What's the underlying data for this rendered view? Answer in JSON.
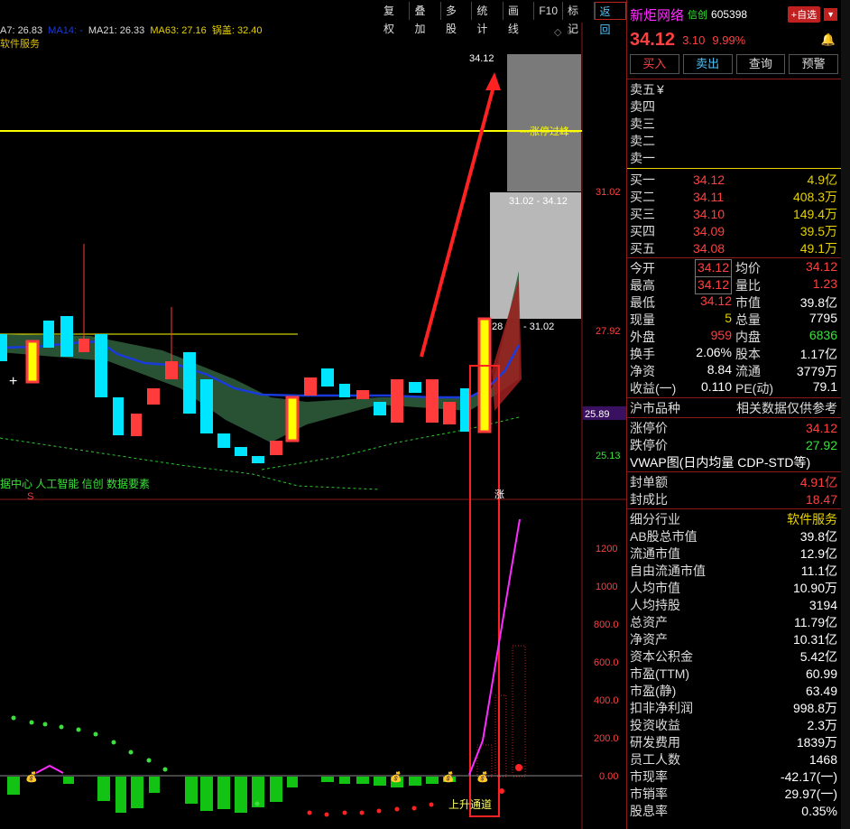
{
  "toolbar": [
    "复权",
    "叠加",
    "多股",
    "统计",
    "画线",
    "F10",
    "标记",
    "返回"
  ],
  "ma_legend": {
    "ma7": "A7: 26.83",
    "ma14": "MA14: -",
    "ma21": "MA21: 26.33",
    "ma63": "MA63: 27.16",
    "guogai": "锅盖: 32.40"
  },
  "sector_label": "软件服务",
  "chart": {
    "price_axis": [
      "31.02",
      "27.92",
      "25.13"
    ],
    "current_price_tag": "25.89",
    "high_label": "34.12",
    "limit_label": "---涨停过峰---",
    "range_label": "31.02 - 34.12",
    "range_label_2": "28",
    "range_label_3": "- 31.02",
    "concept_text": "据中心 人工智能 信创 数据要素",
    "s_marker": "S",
    "zhang_marker": "涨",
    "indicator_axis": [
      "1200",
      "1000",
      "800.0",
      "600.0",
      "400.0",
      "200.0",
      "0.00"
    ],
    "rising_channel": "上升通道",
    "colors": {
      "up": "#ff3b3b",
      "down": "#00e5ff",
      "ma": "#1a3bdc",
      "limit": "#ffff00",
      "magenta": "#ff2cff"
    }
  },
  "stock": {
    "name": "新炬网络",
    "tag": "信创",
    "code": "605398",
    "fav_button": "+自选",
    "price": "34.12",
    "change": "3.10",
    "pct": "9.99%"
  },
  "actions": [
    "买入",
    "卖出",
    "查询",
    "预警"
  ],
  "sell_levels": [
    {
      "label": "卖五",
      "price": "",
      "vol": "¥"
    },
    {
      "label": "卖四",
      "price": "",
      "vol": ""
    },
    {
      "label": "卖三",
      "price": "",
      "vol": ""
    },
    {
      "label": "卖二",
      "price": "",
      "vol": ""
    },
    {
      "label": "卖一",
      "price": "",
      "vol": ""
    }
  ],
  "buy_levels": [
    {
      "label": "买一",
      "price": "34.12",
      "vol": "4.9亿"
    },
    {
      "label": "买二",
      "price": "34.11",
      "vol": "408.3万"
    },
    {
      "label": "买三",
      "price": "34.10",
      "vol": "149.4万"
    },
    {
      "label": "买四",
      "price": "34.09",
      "vol": "39.5万"
    },
    {
      "label": "买五",
      "price": "34.08",
      "vol": "49.1万"
    }
  ],
  "quote": [
    [
      {
        "l": "今开",
        "v": "34.12",
        "c": "red",
        "box": true
      },
      {
        "l": "均价",
        "v": "34.12",
        "c": "red"
      }
    ],
    [
      {
        "l": "最高",
        "v": "34.12",
        "c": "red",
        "box": true
      },
      {
        "l": "量比",
        "v": "1.23",
        "c": "red"
      }
    ],
    [
      {
        "l": "最低",
        "v": "34.12",
        "c": "red"
      },
      {
        "l": "市值",
        "v": "39.8亿",
        "c": "white"
      }
    ],
    [
      {
        "l": "现量",
        "v": "5",
        "c": "yellow"
      },
      {
        "l": "总量",
        "v": "7795",
        "c": "white"
      }
    ],
    [
      {
        "l": "外盘",
        "v": "959",
        "c": "red"
      },
      {
        "l": "内盘",
        "v": "6836",
        "c": "green"
      }
    ],
    [
      {
        "l": "换手",
        "v": "2.06%",
        "c": "white"
      },
      {
        "l": "股本",
        "v": "1.17亿",
        "c": "white"
      }
    ],
    [
      {
        "l": "净资",
        "v": "8.84",
        "c": "white"
      },
      {
        "l": "流通",
        "v": "3779万",
        "c": "white"
      }
    ],
    [
      {
        "l": "收益(一)",
        "v": "0.110",
        "c": "white"
      },
      {
        "l": "PE(动)",
        "v": "79.1",
        "c": "white"
      }
    ]
  ],
  "market_row": {
    "left": "沪市品种",
    "right": "相关数据仅供参考"
  },
  "limit_prices": [
    {
      "l": "涨停价",
      "v": "34.12",
      "c": "red"
    },
    {
      "l": "跌停价",
      "v": "27.92",
      "c": "green"
    }
  ],
  "vwap": "VWAP图(日内均量 CDP-STD等)",
  "seal": [
    {
      "l": "封单额",
      "v": "4.91亿",
      "c": "red"
    },
    {
      "l": "封成比",
      "v": "18.47",
      "c": "red"
    }
  ],
  "industry": {
    "l": "细分行业",
    "v": "软件服务"
  },
  "fundamentals": [
    {
      "l": "AB股总市值",
      "v": "39.8亿"
    },
    {
      "l": "流通市值",
      "v": "12.9亿"
    },
    {
      "l": "自由流通市值",
      "v": "11.1亿"
    },
    {
      "l": "人均市值",
      "v": "10.90万"
    },
    {
      "l": "人均持股",
      "v": "3194"
    },
    {
      "l": "总资产",
      "v": "11.79亿"
    },
    {
      "l": "净资产",
      "v": "10.31亿"
    },
    {
      "l": "资本公积金",
      "v": "5.42亿"
    },
    {
      "l": "市盈(TTM)",
      "v": "60.99"
    },
    {
      "l": "市盈(静)",
      "v": "63.49"
    },
    {
      "l": "扣非净利润",
      "v": "998.8万"
    },
    {
      "l": "投资收益",
      "v": "2.3万"
    },
    {
      "l": "研发费用",
      "v": "1839万"
    },
    {
      "l": "员工人数",
      "v": "1468"
    },
    {
      "l": "市现率",
      "v": "-42.17(一)"
    },
    {
      "l": "市销率",
      "v": "29.97(一)"
    },
    {
      "l": "股息率",
      "v": "0.35%"
    }
  ]
}
